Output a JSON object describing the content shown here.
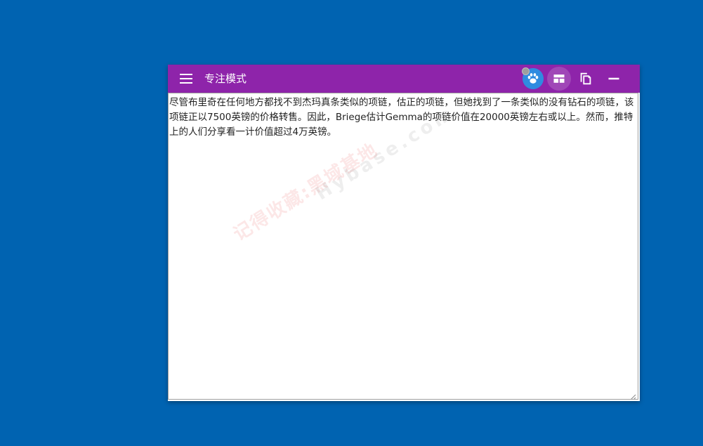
{
  "window": {
    "title": "专注模式"
  },
  "toolbar": {
    "icons": [
      "menu-icon",
      "paw-icon",
      "layout-icon",
      "copy-icon",
      "minimize-icon"
    ]
  },
  "editor": {
    "text": "尽管布里奇在任何地方都找不到杰玛真条类似的项链，估正的项链，但她找到了一条类似的没有钻石的项链，该项链正以7500英镑的价格转售。因此，Briege估计Gemma的项链价值在20000英镑左右或以上。然而，推特上的人们分享看一计价值超过4万英镑。"
  },
  "watermark": {
    "line1": "记得收藏:黑域基地",
    "line2": "Hybase.com"
  },
  "colors": {
    "desktop": "#0063b1",
    "titlebar": "#8e24aa",
    "paw_badge": "#2f8be0"
  }
}
